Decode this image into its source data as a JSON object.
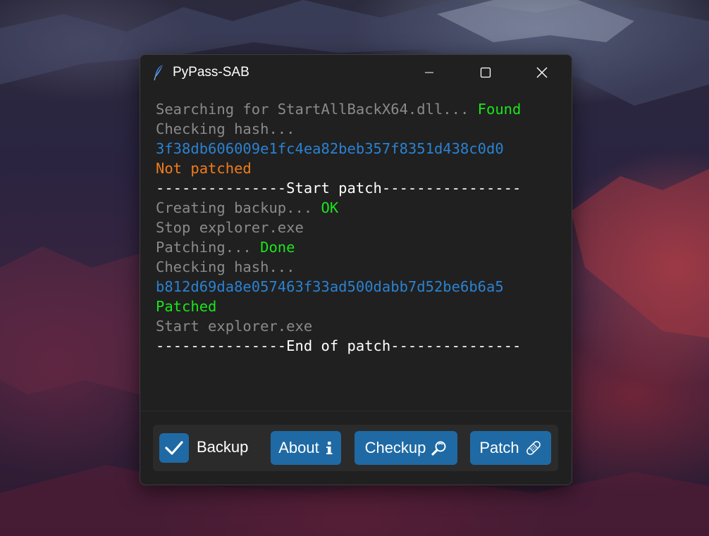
{
  "window": {
    "title": "PyPass-SAB",
    "app_icon": "feather-icon"
  },
  "caption_buttons": {
    "minimize": "minimize-icon",
    "maximize": "maximize-icon",
    "close": "close-icon"
  },
  "log": [
    [
      {
        "text": "Searching for StartAllBackX64.dll... ",
        "color": "gray"
      },
      {
        "text": "Found",
        "color": "green"
      }
    ],
    [
      {
        "text": "Checking hash...",
        "color": "gray"
      }
    ],
    [
      {
        "text": "3f38db606009e1fc4ea82beb357f8351d438c0d0",
        "color": "blue"
      }
    ],
    [
      {
        "text": "Not patched",
        "color": "orange"
      }
    ],
    [
      {
        "text": "---------------Start patch----------------",
        "color": "white"
      }
    ],
    [
      {
        "text": "Creating backup... ",
        "color": "gray"
      },
      {
        "text": "OK",
        "color": "green"
      }
    ],
    [
      {
        "text": "Stop explorer.exe",
        "color": "gray"
      }
    ],
    [
      {
        "text": "Patching... ",
        "color": "gray"
      },
      {
        "text": "Done",
        "color": "green"
      }
    ],
    [
      {
        "text": "Checking hash...",
        "color": "gray"
      }
    ],
    [
      {
        "text": "b812d69da8e057463f33ad500dabb7d52be6b6a5",
        "color": "blue"
      }
    ],
    [
      {
        "text": "Patched",
        "color": "green"
      }
    ],
    [
      {
        "text": "Start explorer.exe",
        "color": "gray"
      }
    ],
    [
      {
        "text": "---------------End of patch---------------",
        "color": "white"
      }
    ]
  ],
  "toolbar": {
    "backup_label": "Backup",
    "backup_checked": true,
    "about_label": "About",
    "about_icon": "info-icon",
    "checkup_label": "Checkup",
    "checkup_icon": "magnifier-icon",
    "patch_label": "Patch",
    "patch_icon": "bandage-icon"
  },
  "colors": {
    "accent": "#1f6aa5",
    "window_bg": "#202020",
    "toolbar_bg": "#2b2b2b",
    "log_gray": "#8a8a8a",
    "log_green": "#19e619",
    "log_blue": "#2a82d2",
    "log_orange": "#f07c1c",
    "log_white": "#ffffff"
  }
}
